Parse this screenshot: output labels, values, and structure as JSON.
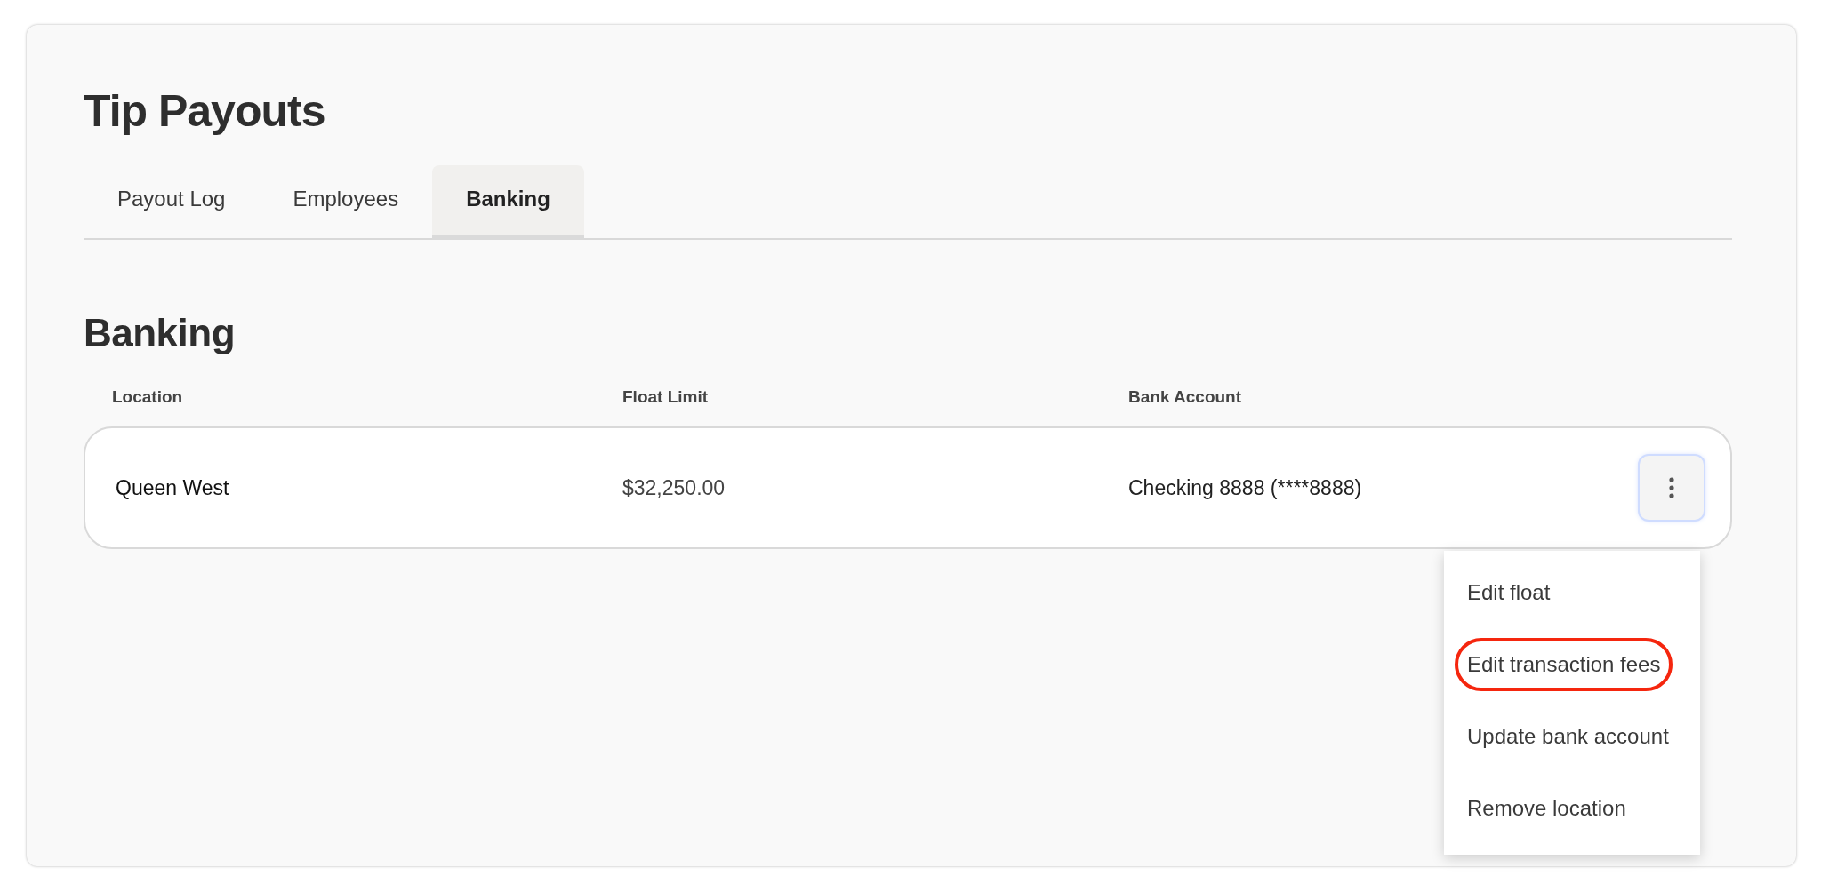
{
  "page": {
    "title": "Tip Payouts"
  },
  "tabs": [
    {
      "label": "Payout Log",
      "selected": false
    },
    {
      "label": "Employees",
      "selected": false
    },
    {
      "label": "Banking",
      "selected": true
    }
  ],
  "section": {
    "title": "Banking"
  },
  "table": {
    "columns": [
      "Location",
      "Float Limit",
      "Bank Account"
    ],
    "rows": [
      {
        "cells": [
          "Queen West",
          "$32,250.00",
          "Checking 8888 (****8888)"
        ],
        "menu_open": true
      }
    ]
  },
  "menu": {
    "items": [
      {
        "label": "Edit float",
        "highlighted": false
      },
      {
        "label": "Edit transaction fees",
        "highlighted": true
      },
      {
        "label": "Update bank account",
        "highlighted": false
      },
      {
        "label": "Remove location",
        "highlighted": false
      }
    ]
  }
}
